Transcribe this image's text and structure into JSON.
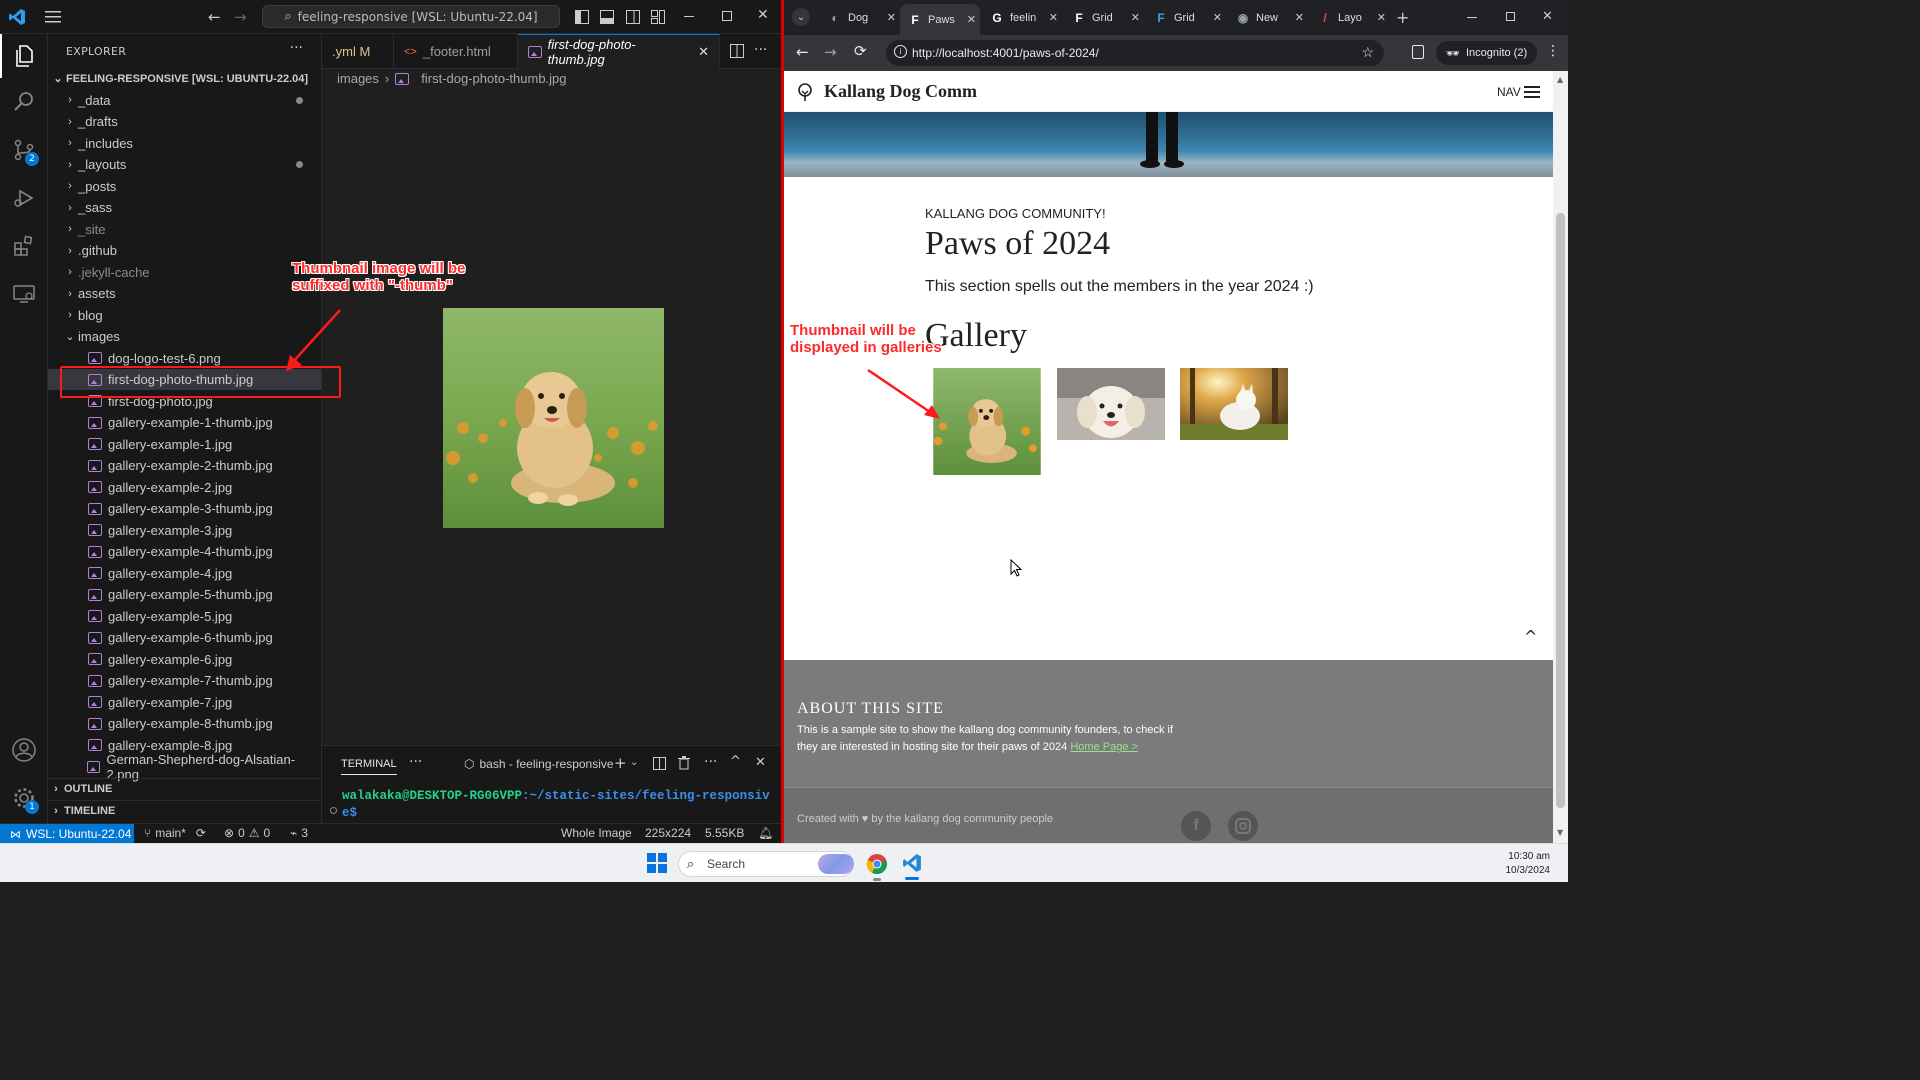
{
  "vscode": {
    "command_center": "feeling-responsive [WSL: Ubuntu-22.04]",
    "explorer": {
      "title": "EXPLORER",
      "more": "···",
      "root": "FEELING-RESPONSIVE [WSL: UBUNTU-22.04]",
      "items": [
        {
          "label": "_data",
          "type": "folder",
          "modified": true
        },
        {
          "label": "_drafts",
          "type": "folder"
        },
        {
          "label": "_includes",
          "type": "folder"
        },
        {
          "label": "_layouts",
          "type": "folder",
          "modified": true
        },
        {
          "label": "_posts",
          "type": "folder"
        },
        {
          "label": "_sass",
          "type": "folder"
        },
        {
          "label": "_site",
          "type": "folder",
          "dim": true
        },
        {
          "label": ".github",
          "type": "folder"
        },
        {
          "label": ".jekyll-cache",
          "type": "folder",
          "dim": true
        },
        {
          "label": "assets",
          "type": "folder"
        },
        {
          "label": "blog",
          "type": "folder"
        },
        {
          "label": "images",
          "type": "folder-open"
        }
      ],
      "image_files": [
        "dog-logo-test-6.png",
        "first-dog-photo-thumb.jpg",
        "first-dog-photo.jpg",
        "gallery-example-1-thumb.jpg",
        "gallery-example-1.jpg",
        "gallery-example-2-thumb.jpg",
        "gallery-example-2.jpg",
        "gallery-example-3-thumb.jpg",
        "gallery-example-3.jpg",
        "gallery-example-4-thumb.jpg",
        "gallery-example-4.jpg",
        "gallery-example-5-thumb.jpg",
        "gallery-example-5.jpg",
        "gallery-example-6-thumb.jpg",
        "gallery-example-6.jpg",
        "gallery-example-7-thumb.jpg",
        "gallery-example-7.jpg",
        "gallery-example-8-thumb.jpg",
        "gallery-example-8.jpg",
        "German-Shepherd-dog-Alsatian-2.png"
      ],
      "outline": "OUTLINE",
      "timeline": "TIMELINE"
    },
    "tabs": [
      {
        "label": ".yml",
        "modified": "M"
      },
      {
        "label": "_footer.html"
      },
      {
        "label": "first-dog-photo-thumb.jpg",
        "active": true
      }
    ],
    "breadcrumb": {
      "folder": "images",
      "file": "first-dog-photo-thumb.jpg"
    },
    "terminal": {
      "tab": "TERMINAL",
      "shell": "bash - feeling-responsive",
      "prompt_user": "walakaka@DESKTOP-RG06VPP",
      "prompt_path": ":~/static-sites/feeling-responsiv",
      "prompt_line2": "e$"
    },
    "status": {
      "remote": "WSL: Ubuntu-22.04",
      "branch": "main*",
      "errors": "0",
      "warnings": "0",
      "ports": "3",
      "view_mode": "Whole Image",
      "dimensions": "225x224",
      "file_size": "5.55KB"
    },
    "badges": {
      "source_control": "2",
      "settings": "1"
    }
  },
  "annotations": {
    "thumb_suffix": [
      "Thumbnail image will be",
      "suffixed with \"-thumb\""
    ],
    "gallery": [
      "Thumbnail will be",
      "displayed in galleries"
    ]
  },
  "browser": {
    "tabs": [
      "Dog",
      "Paws",
      "feelin",
      "Grid",
      "Grid",
      "New",
      "Layo"
    ],
    "url": "http://localhost:4001/paws-of-2024/",
    "incognito": "Incognito (2)",
    "site": {
      "brand": "Kallang Dog Comm",
      "nav_label": "NAV",
      "subheading": "KALLANG DOG COMMUNITY!",
      "title": "Paws of 2024",
      "intro": "This section spells out the members in the year 2024 :)",
      "gallery_heading": "Gallery",
      "about_heading": "ABOUT THIS SITE",
      "about_text_1": "This is a sample site to show the kallang dog community founders, to check if",
      "about_text_2": "they are interested in hosting site for their paws of 2024",
      "home_link": "Home Page >",
      "credit": "Created with ♥ by the kallang dog community people"
    }
  },
  "taskbar": {
    "search": "Search",
    "time": "10:30 am",
    "date": "10/3/2024"
  },
  "colors": {
    "vscode_accent": "#0078d4",
    "annotation_red": "#ff2a2a",
    "footer_link": "#9be28c"
  }
}
